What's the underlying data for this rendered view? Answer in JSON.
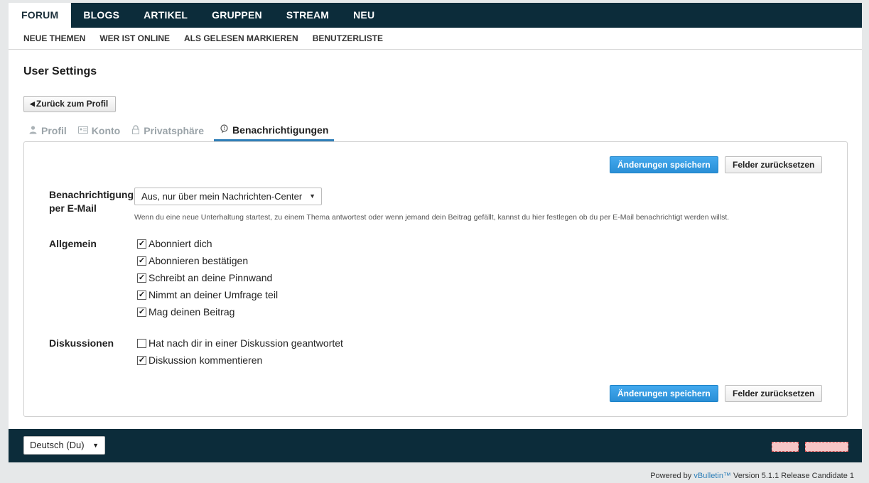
{
  "topnav": {
    "tabs": [
      {
        "label": "FORUM",
        "active": true
      },
      {
        "label": "BLOGS",
        "active": false
      },
      {
        "label": "ARTIKEL",
        "active": false
      },
      {
        "label": "GRUPPEN",
        "active": false
      },
      {
        "label": "STREAM",
        "active": false
      },
      {
        "label": "NEU",
        "active": false
      }
    ]
  },
  "subnav": {
    "items": [
      "NEUE THEMEN",
      "WER IST ONLINE",
      "ALS GELESEN MARKIEREN",
      "BENUTZERLISTE"
    ]
  },
  "page": {
    "title": "User Settings",
    "back_label": "Zurück zum Profil"
  },
  "settings_tabs": [
    {
      "label": "Profil",
      "icon": "user-icon",
      "active": false
    },
    {
      "label": "Konto",
      "icon": "id-card-icon",
      "active": false
    },
    {
      "label": "Privatsphäre",
      "icon": "lock-icon",
      "active": false
    },
    {
      "label": "Benachrichtigungen",
      "icon": "chat-bubble-icon",
      "active": true
    }
  ],
  "buttons": {
    "save": "Änderungen speichern",
    "reset": "Felder zurücksetzen"
  },
  "email_notify": {
    "label_line1": "Benachrichtigung",
    "label_line2": "per E-Mail",
    "selected": "Aus, nur über mein Nachrichten-Center",
    "hint": "Wenn du eine neue Unterhaltung startest, zu einem Thema antwortest oder wenn jemand dein Beitrag gefällt, kannst du hier festlegen ob du per E-Mail benachrichtigt werden willst."
  },
  "general": {
    "label": "Allgemein",
    "options": [
      {
        "label": "Abonniert dich",
        "checked": true
      },
      {
        "label": "Abonnieren bestätigen",
        "checked": true
      },
      {
        "label": "Schreibt an deine Pinnwand",
        "checked": true
      },
      {
        "label": "Nimmt an deiner Umfrage teil",
        "checked": true
      },
      {
        "label": "Mag deinen Beitrag",
        "checked": true
      }
    ]
  },
  "discussions": {
    "label": "Diskussionen",
    "options": [
      {
        "label": "Hat nach dir in einer Diskussion geantwortet",
        "checked": false
      },
      {
        "label": "Diskussion kommentieren",
        "checked": true
      }
    ]
  },
  "footer": {
    "language": "Deutsch (Du)",
    "powered_prefix": "Powered by ",
    "powered_brand": "vBulletin™",
    "powered_suffix": " Version 5.1.1 Release Candidate 1"
  },
  "colors": {
    "nav_bg": "#0c2c3a",
    "accent": "#2f7fb8",
    "primary_button": "#2a8fd6"
  }
}
